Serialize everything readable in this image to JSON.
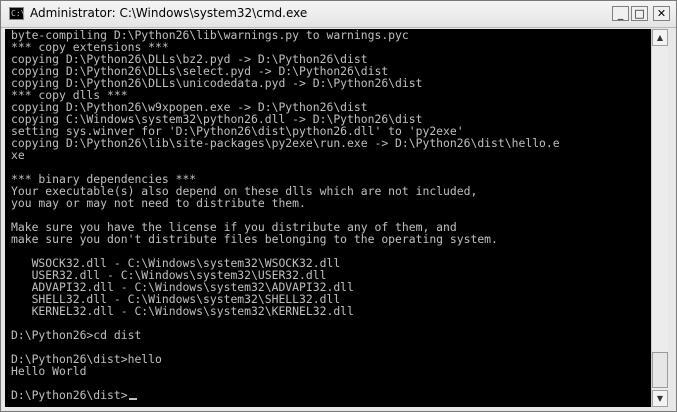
{
  "window": {
    "title": "Administrator: C:\\Windows\\system32\\cmd.exe",
    "icon": "cmd-icon",
    "icon_glyph": "C:\\",
    "controls": {
      "minimize": "_",
      "maximize": "□",
      "close": "✕"
    }
  },
  "console": {
    "text_color": "#c0c0c0",
    "background": "#000000",
    "lines": [
      "byte-compiling D:\\Python26\\lib\\warnings.py to warnings.pyc",
      "*** copy extensions ***",
      "copying D:\\Python26\\DLLs\\bz2.pyd -> D:\\Python26\\dist",
      "copying D:\\Python26\\DLLs\\select.pyd -> D:\\Python26\\dist",
      "copying D:\\Python26\\DLLs\\unicodedata.pyd -> D:\\Python26\\dist",
      "*** copy dlls ***",
      "copying D:\\Python26\\w9xpopen.exe -> D:\\Python26\\dist",
      "copying C:\\Windows\\system32\\python26.dll -> D:\\Python26\\dist",
      "setting sys.winver for 'D:\\Python26\\dist\\python26.dll' to 'py2exe'",
      "copying D:\\Python26\\lib\\site-packages\\py2exe\\run.exe -> D:\\Python26\\dist\\hello.e",
      "xe",
      "",
      "*** binary dependencies ***",
      "Your executable(s) also depend on these dlls which are not included,",
      "you may or may not need to distribute them.",
      "",
      "Make sure you have the license if you distribute any of them, and",
      "make sure you don't distribute files belonging to the operating system.",
      "",
      "   WSOCK32.dll - C:\\Windows\\system32\\WSOCK32.dll",
      "   USER32.dll - C:\\Windows\\system32\\USER32.dll",
      "   ADVAPI32.dll - C:\\Windows\\system32\\ADVAPI32.dll",
      "   SHELL32.dll - C:\\Windows\\system32\\SHELL32.dll",
      "   KERNEL32.dll - C:\\Windows\\system32\\KERNEL32.dll",
      "",
      "D:\\Python26>cd dist",
      "",
      "D:\\Python26\\dist>hello",
      "Hello World",
      "",
      "D:\\Python26\\dist>"
    ]
  },
  "scrollbar": {
    "up_glyph": "▲",
    "down_glyph": "▼"
  }
}
